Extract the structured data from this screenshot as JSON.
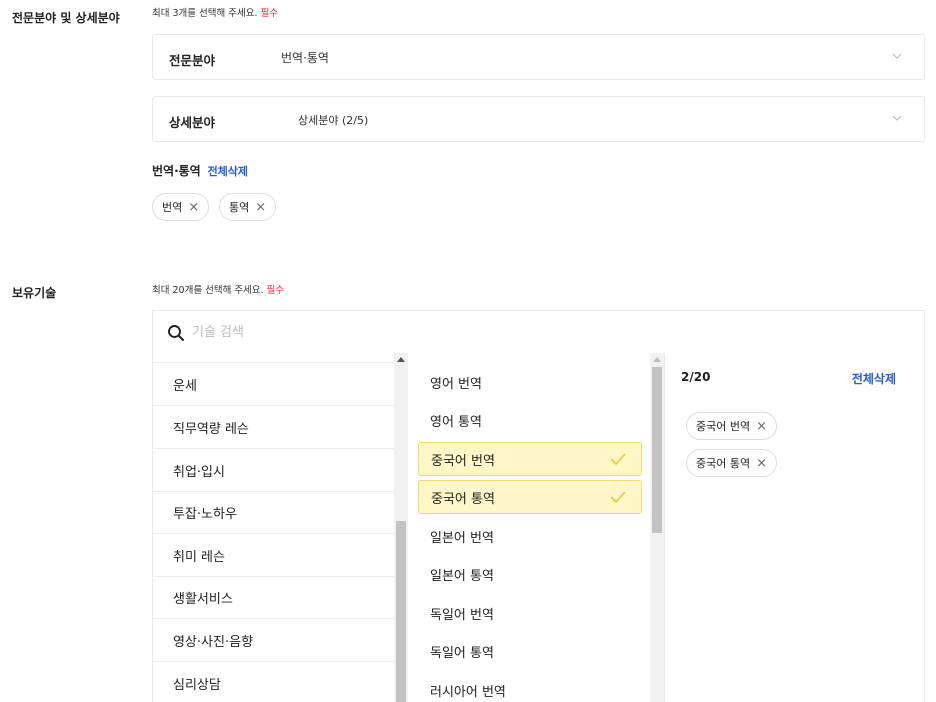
{
  "specialty": {
    "section_title": "전문분야 및 상세분야",
    "hint": "최대 3개를 선택해 주세요.",
    "required": "필수",
    "field_label": "전문분야",
    "field_value": "번역·통역",
    "detail_label": "상세분야",
    "detail_value": "상세분야 (2/5)",
    "selected_group": "번역·통역",
    "clear_all": "전체삭제",
    "chips": [
      "번역",
      "통역"
    ]
  },
  "skills": {
    "section_title": "보유기술",
    "hint": "최대 20개를 선택해 주세요.",
    "required": "필수",
    "search_placeholder": "기술 검색",
    "categories": [
      "운세",
      "직무역량 레슨",
      "취업·입시",
      "투잡·노하우",
      "취미 레슨",
      "생활서비스",
      "영상·사진·음향",
      "심리상담"
    ],
    "subitems": [
      {
        "label": "영어 번역",
        "selected": false
      },
      {
        "label": "영어 통역",
        "selected": false
      },
      {
        "label": "중국어 번역",
        "selected": true
      },
      {
        "label": "중국어 통역",
        "selected": true
      },
      {
        "label": "일본어 번역",
        "selected": false
      },
      {
        "label": "일본어 통역",
        "selected": false
      },
      {
        "label": "독일어 번역",
        "selected": false
      },
      {
        "label": "독일어 통역",
        "selected": false
      },
      {
        "label": "러시아어 번역",
        "selected": false
      }
    ],
    "count": "2/20",
    "clear_all": "전체삭제",
    "selected_chips": [
      "중국어 번역",
      "중국어 통역"
    ],
    "accent_color": "#2a5bd7",
    "selected_bg": "#fff7c7"
  },
  "icons": {
    "close": "×",
    "search_icon": "search-icon",
    "chevron_icon": "chevron-down-icon",
    "check_icon": "check-icon"
  }
}
